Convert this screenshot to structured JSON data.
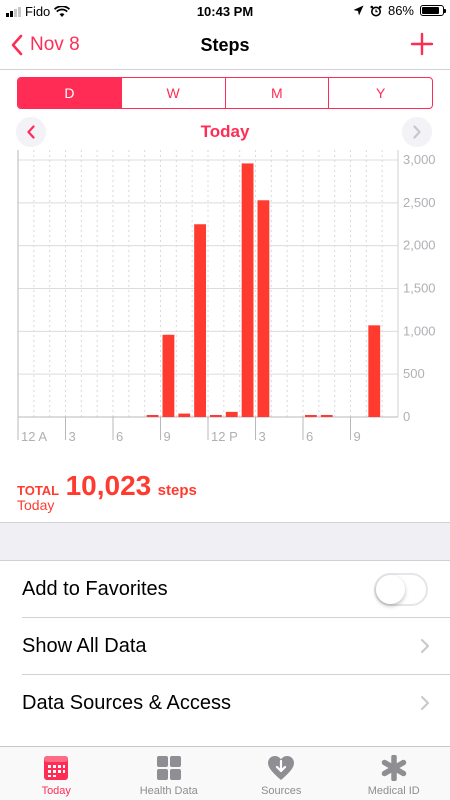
{
  "status": {
    "carrier": "Fido",
    "time": "10:43 PM",
    "battery": "86%",
    "battery_level": 0.86
  },
  "nav": {
    "back_label": "Nov 8",
    "title": "Steps"
  },
  "segments": [
    "D",
    "W",
    "M",
    "Y"
  ],
  "segment_selected": "D",
  "date_label": "Today",
  "chart_data": {
    "type": "bar",
    "x_tick_labels": [
      "12 A",
      "3",
      "6",
      "9",
      "12 P",
      "3",
      "6",
      "9"
    ],
    "date_label": "Nov 8",
    "categories": [
      "0",
      "1",
      "2",
      "3",
      "4",
      "5",
      "6",
      "7",
      "8",
      "9",
      "10",
      "11",
      "12",
      "13",
      "14",
      "15",
      "16",
      "17",
      "18",
      "19",
      "20",
      "21",
      "22",
      "23"
    ],
    "values": [
      0,
      0,
      0,
      0,
      0,
      0,
      0,
      0,
      10,
      960,
      40,
      2250,
      20,
      60,
      2960,
      2530,
      0,
      0,
      10,
      10,
      0,
      0,
      1070,
      0
    ],
    "y_tick_labels": [
      "0",
      "500",
      "1,000",
      "1,500",
      "2,000",
      "2,500",
      "3,000"
    ],
    "ylim": [
      0,
      3000
    ],
    "bar_color": "#ff3b30"
  },
  "total": {
    "label": "TOTAL",
    "value": "10,023",
    "unit": "steps",
    "period": "Today"
  },
  "list": {
    "favorites": "Add to Favorites",
    "show_all": "Show All Data",
    "sources": "Data Sources & Access"
  },
  "tabs": [
    {
      "label": "Today",
      "icon": "calendar-icon",
      "active": true
    },
    {
      "label": "Health Data",
      "icon": "grid-icon",
      "active": false
    },
    {
      "label": "Sources",
      "icon": "heart-download-icon",
      "active": false
    },
    {
      "label": "Medical ID",
      "icon": "asterisk-icon",
      "active": false
    }
  ],
  "colors": {
    "accent": "#ff2d55",
    "bar": "#ff3b30"
  }
}
